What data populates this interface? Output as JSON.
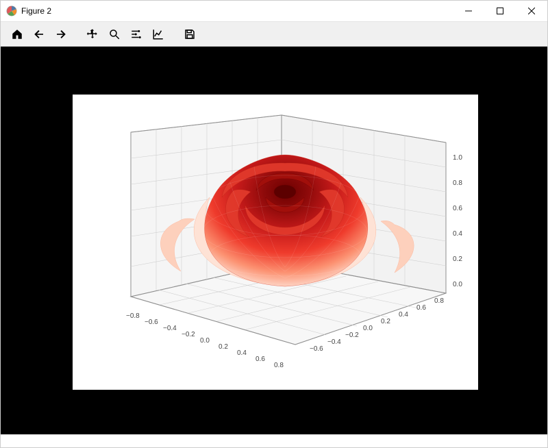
{
  "window": {
    "title": "Figure 2"
  },
  "toolbar": {
    "home": "home",
    "back": "back",
    "forward": "forward",
    "pan": "pan",
    "zoom": "zoom",
    "configure": "configure-subplots",
    "edit": "edit-axis",
    "save": "save"
  },
  "chart_data": {
    "type": "surface-3d",
    "description": "Red 3D rose-shaped parametric surface (matplotlib Axes3D, Reds colormap)",
    "x_axis": {
      "ticks": [
        -0.8,
        -0.6,
        -0.4,
        -0.2,
        0.0,
        0.2,
        0.4,
        0.6,
        0.8
      ],
      "range": [
        -0.9,
        0.9
      ]
    },
    "y_axis": {
      "ticks": [
        -0.6,
        -0.4,
        -0.2,
        0.0,
        0.2,
        0.4,
        0.6,
        0.8
      ],
      "range": [
        -0.7,
        0.9
      ]
    },
    "z_axis": {
      "ticks": [
        0.0,
        0.2,
        0.4,
        0.6,
        0.8,
        1.0
      ],
      "range": [
        0.0,
        1.0
      ]
    },
    "title": "",
    "xlabel": "",
    "ylabel": "",
    "zlabel": "",
    "grid": true,
    "colormap": "Reds"
  },
  "ticks": {
    "z": [
      "1.0",
      "0.8",
      "0.6",
      "0.4",
      "0.2",
      "0.0"
    ],
    "y": [
      "0.8",
      "0.6",
      "0.4",
      "0.2",
      "0.0",
      "−0.2",
      "−0.4",
      "−0.6"
    ],
    "x": [
      "−0.8",
      "−0.6",
      "−0.4",
      "−0.2",
      "0.0",
      "0.2",
      "0.4",
      "0.6",
      "0.8"
    ]
  }
}
